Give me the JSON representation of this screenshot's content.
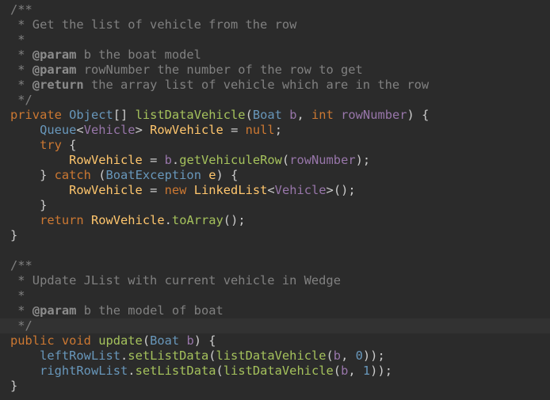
{
  "editor": {
    "colors": {
      "background": "#2b2b2b",
      "current_line": "#323232",
      "comment": "#808080",
      "keyword": "#cc7832",
      "type": "#6897bb",
      "method": "#a5c25c",
      "parameter": "#9876aa",
      "variable": "#ffc66d"
    },
    "current_line_index": 21,
    "lines": [
      [
        [
          "/**",
          "comment"
        ]
      ],
      [
        [
          " * Get the list of vehicle from the row",
          "comment"
        ]
      ],
      [
        [
          " *",
          "comment"
        ]
      ],
      [
        [
          " * ",
          "comment"
        ],
        [
          "@param",
          "doctag"
        ],
        [
          " b the boat model",
          "comment"
        ]
      ],
      [
        [
          " * ",
          "comment"
        ],
        [
          "@param",
          "doctag"
        ],
        [
          " rowNumber the number of the row to get",
          "comment"
        ]
      ],
      [
        [
          " * ",
          "comment"
        ],
        [
          "@return",
          "doctag"
        ],
        [
          " the array list of vehicle which are in the row",
          "comment"
        ]
      ],
      [
        [
          " */",
          "comment"
        ]
      ],
      [
        [
          "private ",
          "keyword"
        ],
        [
          "Object",
          "type"
        ],
        [
          "[] ",
          "punct"
        ],
        [
          "listDataVehicle",
          "method"
        ],
        [
          "(",
          "punct"
        ],
        [
          "Boat",
          "type"
        ],
        [
          " ",
          "punct"
        ],
        [
          "b",
          "param"
        ],
        [
          ", ",
          "punct"
        ],
        [
          "int",
          "keyword"
        ],
        [
          " ",
          "punct"
        ],
        [
          "rowNumber",
          "param"
        ],
        [
          ") {",
          "punct"
        ]
      ],
      [
        [
          "    ",
          "punct"
        ],
        [
          "Queue",
          "type"
        ],
        [
          "<",
          "punct"
        ],
        [
          "Vehicle",
          "param"
        ],
        [
          "> ",
          "punct"
        ],
        [
          "RowVehicle",
          "field"
        ],
        [
          " = ",
          "punct"
        ],
        [
          "null",
          "keyword"
        ],
        [
          ";",
          "punct"
        ]
      ],
      [
        [
          "    ",
          "punct"
        ],
        [
          "try",
          "keyword"
        ],
        [
          " {",
          "punct"
        ]
      ],
      [
        [
          "        ",
          "punct"
        ],
        [
          "RowVehicle",
          "field"
        ],
        [
          " = ",
          "punct"
        ],
        [
          "b",
          "param"
        ],
        [
          ".",
          "punct"
        ],
        [
          "getVehiculeRow",
          "method"
        ],
        [
          "(",
          "punct"
        ],
        [
          "rowNumber",
          "param"
        ],
        [
          ");",
          "punct"
        ]
      ],
      [
        [
          "    } ",
          "punct"
        ],
        [
          "catch",
          "keyword"
        ],
        [
          " (",
          "punct"
        ],
        [
          "BoatException",
          "type"
        ],
        [
          " ",
          "punct"
        ],
        [
          "e",
          "field"
        ],
        [
          ") {",
          "punct"
        ]
      ],
      [
        [
          "        ",
          "punct"
        ],
        [
          "RowVehicle",
          "field"
        ],
        [
          " = ",
          "punct"
        ],
        [
          "new",
          "keyword"
        ],
        [
          " ",
          "punct"
        ],
        [
          "LinkedList",
          "field"
        ],
        [
          "<",
          "punct"
        ],
        [
          "Vehicle",
          "param"
        ],
        [
          ">();",
          "punct"
        ]
      ],
      [
        [
          "    }",
          "punct"
        ]
      ],
      [
        [
          "    ",
          "punct"
        ],
        [
          "return",
          "keyword"
        ],
        [
          " ",
          "punct"
        ],
        [
          "RowVehicle",
          "field"
        ],
        [
          ".",
          "punct"
        ],
        [
          "toArray",
          "method"
        ],
        [
          "();",
          "punct"
        ]
      ],
      [
        [
          "}",
          "punct"
        ]
      ],
      [],
      [
        [
          "/**",
          "comment"
        ]
      ],
      [
        [
          " * Update JList with current vehicle in Wedge",
          "comment"
        ]
      ],
      [
        [
          " *",
          "comment"
        ]
      ],
      [
        [
          " * ",
          "comment"
        ],
        [
          "@param",
          "doctag"
        ],
        [
          " b the model of boat",
          "comment"
        ]
      ],
      [
        [
          " */",
          "comment"
        ]
      ],
      [
        [
          "public void ",
          "keyword"
        ],
        [
          "update",
          "method"
        ],
        [
          "(",
          "punct"
        ],
        [
          "Boat",
          "type"
        ],
        [
          " ",
          "punct"
        ],
        [
          "b",
          "param"
        ],
        [
          ") {",
          "punct"
        ]
      ],
      [
        [
          "    ",
          "punct"
        ],
        [
          "leftRowList",
          "type"
        ],
        [
          ".",
          "punct"
        ],
        [
          "setListData",
          "method"
        ],
        [
          "(",
          "punct"
        ],
        [
          "listDataVehicle",
          "method"
        ],
        [
          "(",
          "punct"
        ],
        [
          "b",
          "param"
        ],
        [
          ", ",
          "punct"
        ],
        [
          "0",
          "number"
        ],
        [
          "));",
          "punct"
        ]
      ],
      [
        [
          "    ",
          "punct"
        ],
        [
          "rightRowList",
          "type"
        ],
        [
          ".",
          "punct"
        ],
        [
          "setListData",
          "method"
        ],
        [
          "(",
          "punct"
        ],
        [
          "listDataVehicle",
          "method"
        ],
        [
          "(",
          "punct"
        ],
        [
          "b",
          "param"
        ],
        [
          ", ",
          "punct"
        ],
        [
          "1",
          "number"
        ],
        [
          "));",
          "punct"
        ]
      ],
      [
        [
          "}",
          "punct"
        ]
      ]
    ]
  }
}
